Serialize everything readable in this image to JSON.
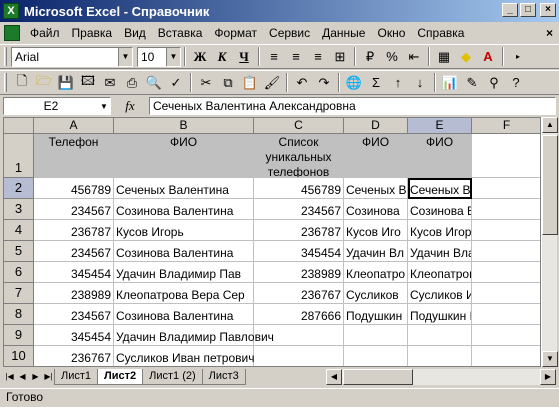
{
  "window": {
    "title": "Microsoft Excel - Справочник"
  },
  "menu": [
    "Файл",
    "Правка",
    "Вид",
    "Вставка",
    "Формат",
    "Сервис",
    "Данные",
    "Окно",
    "Справка"
  ],
  "formatting": {
    "font": "Arial",
    "size": "10"
  },
  "formula_bar": {
    "cell": "E2",
    "fx": "fx",
    "content": "Сеченых Валентина Александровна"
  },
  "columns": [
    "A",
    "B",
    "C",
    "D",
    "E",
    "F"
  ],
  "rows": [
    {
      "num": "1",
      "a": "Телефон",
      "b": "ФИО",
      "c": "Список уникальных телефонов",
      "d": "ФИО",
      "e": "ФИО",
      "f": ""
    },
    {
      "num": "2",
      "a": "456789",
      "b": "Сеченых Валентина",
      "c": "456789",
      "d": "Сеченых В",
      "e": "Сеченых Валентина А",
      "f": ""
    },
    {
      "num": "3",
      "a": "234567",
      "b": "Созинова Валентина",
      "c": "234567",
      "d": "Созинова",
      "e": "Созинова Валентина А",
      "f": ""
    },
    {
      "num": "4",
      "a": "236787",
      "b": "Кусов Игорь",
      "c": "236787",
      "d": "Кусов Иго",
      "e": "Кусов Игорь Вениами",
      "f": ""
    },
    {
      "num": "5",
      "a": "234567",
      "b": "Созинова Валентина",
      "c": "345454",
      "d": "Удачин Вл",
      "e": "Удачин Владимир Па",
      "f": ""
    },
    {
      "num": "6",
      "a": "345454",
      "b": "Удачин Владимир Пав",
      "c": "238989",
      "d": "Клеопатро",
      "e": "Клеопатрова Вера Се",
      "f": ""
    },
    {
      "num": "7",
      "a": "238989",
      "b": "Клеопатрова Вера Сер",
      "c": "236767",
      "d": "Сусликов",
      "e": "Сусликов Иван петров",
      "f": ""
    },
    {
      "num": "8",
      "a": "234567",
      "b": "Созинова Валентина",
      "c": "287666",
      "d": "Подушкин",
      "e": "Подушкин Иван Викто",
      "f": ""
    },
    {
      "num": "9",
      "a": "345454",
      "b": "Удачин Владимир Павлович",
      "c": "",
      "d": "",
      "e": "",
      "f": ""
    },
    {
      "num": "10",
      "a": "236767",
      "b": "Сусликов Иван петрович",
      "c": "",
      "d": "",
      "e": "",
      "f": ""
    }
  ],
  "sheets": [
    "Лист1",
    "Лист2",
    "Лист1 (2)",
    "Лист3"
  ],
  "active_sheet": "Лист2",
  "status": "Готово"
}
